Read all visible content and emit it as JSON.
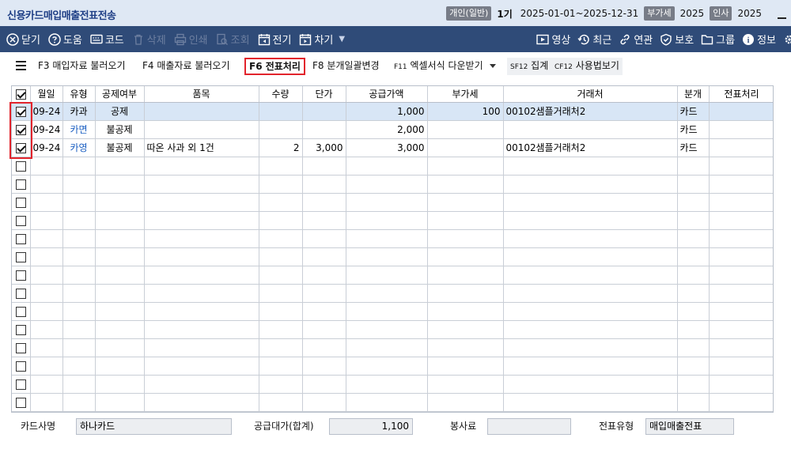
{
  "title": "신용카드매입매출전표전송",
  "header": {
    "type_pill": "개인(일반)",
    "period": "1기",
    "date_range": "2025-01-01~2025-12-31",
    "vat_pill": "부가세",
    "vat_year": "2025",
    "hr_pill": "인사",
    "hr_year": "2025"
  },
  "toolbar": {
    "close": "닫기",
    "help": "도움",
    "code": "코드",
    "delete": "삭제",
    "print": "인쇄",
    "view": "조회",
    "prev": "전기",
    "next": "차기",
    "video": "영상",
    "recent": "최근",
    "related": "연관",
    "protect": "보호",
    "group": "그룹",
    "info": "정보"
  },
  "fnbar": {
    "f3": "F3 매입자료 불러오기",
    "f4": "F4 매출자료 불러오기",
    "f6": "F6 전표처리",
    "f8": "F8 분개일괄변경",
    "f11_key": "F11",
    "f11_label": "엑셀서식 다운받기",
    "sf12_key": "SF12",
    "sf12_label": "집계",
    "cf12_key": "CF12",
    "cf12_label": "사용법보기"
  },
  "grid": {
    "columns": [
      "월일",
      "유형",
      "공제여부",
      "품목",
      "수량",
      "단가",
      "공급가액",
      "부가세",
      "거래처",
      "분개",
      "전표처리"
    ],
    "rows": [
      {
        "checked": true,
        "date": "09-24",
        "type": "카과",
        "deduct": "공제",
        "item": "",
        "qty": "",
        "price": "",
        "supply": "1,000",
        "vat": "100",
        "vendor_code": "00102",
        "vendor_name": "샘플거래처2",
        "journal": "카드",
        "processed": ""
      },
      {
        "checked": true,
        "date": "09-24",
        "type": "카면",
        "deduct": "불공제",
        "item": "",
        "qty": "",
        "price": "",
        "supply": "2,000",
        "vat": "",
        "vendor_code": "",
        "vendor_name": "",
        "journal": "카드",
        "processed": ""
      },
      {
        "checked": true,
        "date": "09-24",
        "type": "카영",
        "deduct": "불공제",
        "item": "따온 사과 외 1건",
        "qty": "2",
        "price": "3,000",
        "supply": "3,000",
        "vat": "",
        "vendor_code": "00102",
        "vendor_name": "샘플거래처2",
        "journal": "카드",
        "processed": ""
      }
    ],
    "empty_rows": 14
  },
  "summary": {
    "card_label": "카드사명",
    "card_value": "하나카드",
    "total_label": "공급대가(합계)",
    "total_value": "1,100",
    "tip_label": "봉사료",
    "tip_value": "",
    "voucher_label": "전표유형",
    "voucher_value": "매입매출전표"
  },
  "colors": {
    "title_bg": "#dfe8f4",
    "toolbar_bg": "#2f4b78",
    "selected_row": "#d8e6f6",
    "highlight": "#e2242c"
  }
}
